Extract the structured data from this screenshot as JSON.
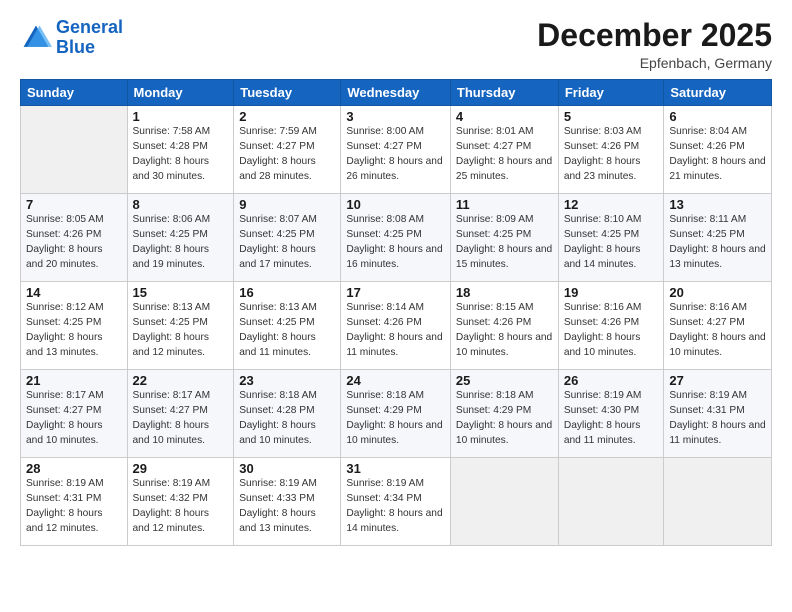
{
  "logo": {
    "line1": "General",
    "line2": "Blue"
  },
  "title": "December 2025",
  "location": "Epfenbach, Germany",
  "days_of_week": [
    "Sunday",
    "Monday",
    "Tuesday",
    "Wednesday",
    "Thursday",
    "Friday",
    "Saturday"
  ],
  "weeks": [
    [
      {
        "num": "",
        "info": ""
      },
      {
        "num": "1",
        "info": "Sunrise: 7:58 AM\nSunset: 4:28 PM\nDaylight: 8 hours\nand 30 minutes."
      },
      {
        "num": "2",
        "info": "Sunrise: 7:59 AM\nSunset: 4:27 PM\nDaylight: 8 hours\nand 28 minutes."
      },
      {
        "num": "3",
        "info": "Sunrise: 8:00 AM\nSunset: 4:27 PM\nDaylight: 8 hours\nand 26 minutes."
      },
      {
        "num": "4",
        "info": "Sunrise: 8:01 AM\nSunset: 4:27 PM\nDaylight: 8 hours\nand 25 minutes."
      },
      {
        "num": "5",
        "info": "Sunrise: 8:03 AM\nSunset: 4:26 PM\nDaylight: 8 hours\nand 23 minutes."
      },
      {
        "num": "6",
        "info": "Sunrise: 8:04 AM\nSunset: 4:26 PM\nDaylight: 8 hours\nand 21 minutes."
      }
    ],
    [
      {
        "num": "7",
        "info": "Sunrise: 8:05 AM\nSunset: 4:26 PM\nDaylight: 8 hours\nand 20 minutes."
      },
      {
        "num": "8",
        "info": "Sunrise: 8:06 AM\nSunset: 4:25 PM\nDaylight: 8 hours\nand 19 minutes."
      },
      {
        "num": "9",
        "info": "Sunrise: 8:07 AM\nSunset: 4:25 PM\nDaylight: 8 hours\nand 17 minutes."
      },
      {
        "num": "10",
        "info": "Sunrise: 8:08 AM\nSunset: 4:25 PM\nDaylight: 8 hours\nand 16 minutes."
      },
      {
        "num": "11",
        "info": "Sunrise: 8:09 AM\nSunset: 4:25 PM\nDaylight: 8 hours\nand 15 minutes."
      },
      {
        "num": "12",
        "info": "Sunrise: 8:10 AM\nSunset: 4:25 PM\nDaylight: 8 hours\nand 14 minutes."
      },
      {
        "num": "13",
        "info": "Sunrise: 8:11 AM\nSunset: 4:25 PM\nDaylight: 8 hours\nand 13 minutes."
      }
    ],
    [
      {
        "num": "14",
        "info": "Sunrise: 8:12 AM\nSunset: 4:25 PM\nDaylight: 8 hours\nand 13 minutes."
      },
      {
        "num": "15",
        "info": "Sunrise: 8:13 AM\nSunset: 4:25 PM\nDaylight: 8 hours\nand 12 minutes."
      },
      {
        "num": "16",
        "info": "Sunrise: 8:13 AM\nSunset: 4:25 PM\nDaylight: 8 hours\nand 11 minutes."
      },
      {
        "num": "17",
        "info": "Sunrise: 8:14 AM\nSunset: 4:26 PM\nDaylight: 8 hours\nand 11 minutes."
      },
      {
        "num": "18",
        "info": "Sunrise: 8:15 AM\nSunset: 4:26 PM\nDaylight: 8 hours\nand 10 minutes."
      },
      {
        "num": "19",
        "info": "Sunrise: 8:16 AM\nSunset: 4:26 PM\nDaylight: 8 hours\nand 10 minutes."
      },
      {
        "num": "20",
        "info": "Sunrise: 8:16 AM\nSunset: 4:27 PM\nDaylight: 8 hours\nand 10 minutes."
      }
    ],
    [
      {
        "num": "21",
        "info": "Sunrise: 8:17 AM\nSunset: 4:27 PM\nDaylight: 8 hours\nand 10 minutes."
      },
      {
        "num": "22",
        "info": "Sunrise: 8:17 AM\nSunset: 4:27 PM\nDaylight: 8 hours\nand 10 minutes."
      },
      {
        "num": "23",
        "info": "Sunrise: 8:18 AM\nSunset: 4:28 PM\nDaylight: 8 hours\nand 10 minutes."
      },
      {
        "num": "24",
        "info": "Sunrise: 8:18 AM\nSunset: 4:29 PM\nDaylight: 8 hours\nand 10 minutes."
      },
      {
        "num": "25",
        "info": "Sunrise: 8:18 AM\nSunset: 4:29 PM\nDaylight: 8 hours\nand 10 minutes."
      },
      {
        "num": "26",
        "info": "Sunrise: 8:19 AM\nSunset: 4:30 PM\nDaylight: 8 hours\nand 11 minutes."
      },
      {
        "num": "27",
        "info": "Sunrise: 8:19 AM\nSunset: 4:31 PM\nDaylight: 8 hours\nand 11 minutes."
      }
    ],
    [
      {
        "num": "28",
        "info": "Sunrise: 8:19 AM\nSunset: 4:31 PM\nDaylight: 8 hours\nand 12 minutes."
      },
      {
        "num": "29",
        "info": "Sunrise: 8:19 AM\nSunset: 4:32 PM\nDaylight: 8 hours\nand 12 minutes."
      },
      {
        "num": "30",
        "info": "Sunrise: 8:19 AM\nSunset: 4:33 PM\nDaylight: 8 hours\nand 13 minutes."
      },
      {
        "num": "31",
        "info": "Sunrise: 8:19 AM\nSunset: 4:34 PM\nDaylight: 8 hours\nand 14 minutes."
      },
      {
        "num": "",
        "info": ""
      },
      {
        "num": "",
        "info": ""
      },
      {
        "num": "",
        "info": ""
      }
    ]
  ]
}
